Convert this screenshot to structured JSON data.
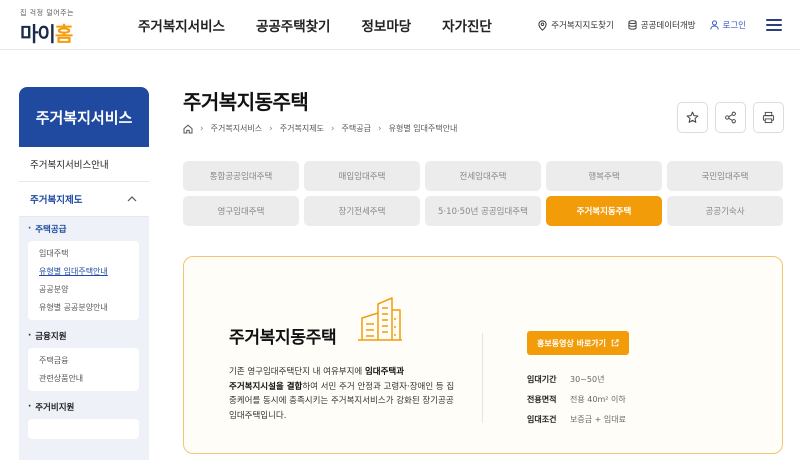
{
  "header": {
    "logo_tagline": "집 걱정 덜어주는",
    "logo_text_1": "마이",
    "logo_text_2": "홈",
    "nav": [
      "주거복지서비스",
      "공공주택찾기",
      "정보마당",
      "자가진단"
    ],
    "util": {
      "map_label": "주거복지지도찾기",
      "data_label": "공공데이터개방",
      "login_label": "로그인"
    }
  },
  "sidebar": {
    "title": "주거복지서비스",
    "top_item": "주거복지서비스안내",
    "active_item": "주거복지제도",
    "groups": [
      {
        "title": "주택공급",
        "items": [
          "임대주택",
          "유형별 임대주택안내",
          "공공분양",
          "유형별 공공분양안내"
        ]
      },
      {
        "title": "금융지원",
        "items": [
          "주택금융",
          "관련상품안내"
        ]
      },
      {
        "title": "주거비지원",
        "items": []
      }
    ]
  },
  "page": {
    "title": "주거복지동주택",
    "breadcrumb": [
      "주거복지서비스",
      "주거복지제도",
      "주택공급",
      "유형별 임대주택안내"
    ]
  },
  "tabs": [
    {
      "label": "통합공공임대주택",
      "active": false
    },
    {
      "label": "매입임대주택",
      "active": false
    },
    {
      "label": "전세임대주택",
      "active": false
    },
    {
      "label": "행복주택",
      "active": false
    },
    {
      "label": "국민임대주택",
      "active": false
    },
    {
      "label": "영구임대주택",
      "active": false
    },
    {
      "label": "장기전세주택",
      "active": false
    },
    {
      "label": "5·10·50년 공공임대주택",
      "active": false
    },
    {
      "label": "주거복지동주택",
      "active": true
    },
    {
      "label": "공공기숙사",
      "active": false
    }
  ],
  "card": {
    "title": "주거복지동주택",
    "desc_1": "기존 영구임대주택단지 내 여유부지에 ",
    "desc_bold_1": "임대주택과",
    "desc_bold_2": "주거복지시설을 결합",
    "desc_2": "하여 서민 주거 안정과 고령자·장애인 등 집중케어를 동시에 충족시키는 주거복지서비스가 강화된 장기공공임대주택입니다.",
    "promo_label": "홍보동영상 바로가기",
    "info": [
      {
        "label": "임대기간",
        "value": "30~50년"
      },
      {
        "label": "전용면적",
        "value": "전용 40m² 이하"
      },
      {
        "label": "임대조건",
        "value": "보증금 + 임대료"
      }
    ]
  },
  "colors": {
    "primary_blue": "#1f4aa0",
    "accent_orange": "#f29c0a"
  }
}
